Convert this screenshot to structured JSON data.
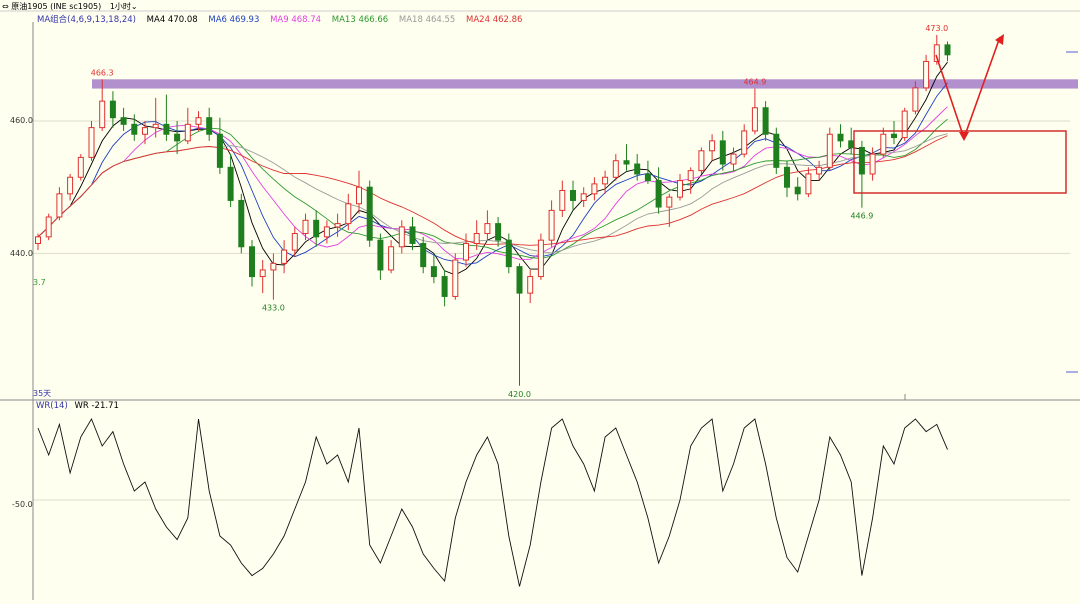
{
  "title_bar": {
    "symbol": "原油1905 (INE sc1905)",
    "period": "1小时"
  },
  "ma_legend": {
    "group": "MA组合(4,6,9,13,18,24)",
    "items": [
      {
        "label": "MA4 470.08",
        "color": "#000000"
      },
      {
        "label": "MA6 469.93",
        "color": "#1E3FBF"
      },
      {
        "label": "MA9 468.74",
        "color": "#E23FE2"
      },
      {
        "label": "MA13 466.66",
        "color": "#2F9A2F"
      },
      {
        "label": "MA18 464.55",
        "color": "#9A9A9A"
      },
      {
        "label": "MA24 462.86",
        "color": "#E03030"
      }
    ]
  },
  "y_ticks": [
    "460.0",
    "440.0"
  ],
  "left_clip_label": "3.7",
  "period_label": "35天",
  "wr_legend": {
    "name": "WR(14)",
    "value": "WR -21.71",
    "tick": "-50.0"
  },
  "colors": {
    "up": "#E03030",
    "down": "#1F7F1F",
    "band": "#A57BC7",
    "box": "#D02020",
    "arrow": "#E02020"
  },
  "chart_data": {
    "type": "candlestick",
    "title": "",
    "ylabel": "",
    "ylim": [
      414,
      476
    ],
    "resistance_band": [
      464.9,
      466.3
    ],
    "annotations": [
      {
        "text": "466.3",
        "index": 6,
        "value": 466.3
      },
      {
        "text": "433.0",
        "index": 22,
        "value": 433.0
      },
      {
        "text": "420.0",
        "index": 45,
        "value": 420.0
      },
      {
        "text": "464.9",
        "index": 67,
        "value": 464.9
      },
      {
        "text": "446.9",
        "index": 77,
        "value": 446.9
      },
      {
        "text": "473.0",
        "index": 84,
        "value": 473.0
      }
    ],
    "candles": [
      [
        441.5,
        443.0,
        440.5,
        442.5
      ],
      [
        442.5,
        446.0,
        442.0,
        445.5
      ],
      [
        445.5,
        450.0,
        445.0,
        449.0
      ],
      [
        449.0,
        452.0,
        448.0,
        451.5
      ],
      [
        451.5,
        455.0,
        451.0,
        454.5
      ],
      [
        454.5,
        460.0,
        454.0,
        459.0
      ],
      [
        459.0,
        466.3,
        458.5,
        463.0
      ],
      [
        463.0,
        464.5,
        459.0,
        460.5
      ],
      [
        460.5,
        462.0,
        458.5,
        459.5
      ],
      [
        459.5,
        461.0,
        457.0,
        458.0
      ],
      [
        458.0,
        460.0,
        456.5,
        459.0
      ],
      [
        459.0,
        463.5,
        457.5,
        459.5
      ],
      [
        459.5,
        464.0,
        457.0,
        458.0
      ],
      [
        458.0,
        460.0,
        455.0,
        457.0
      ],
      [
        457.0,
        462.0,
        456.5,
        459.5
      ],
      [
        459.5,
        461.5,
        458.5,
        460.5
      ],
      [
        460.5,
        462.0,
        457.0,
        458.0
      ],
      [
        458.0,
        460.5,
        452.0,
        453.0
      ],
      [
        453.0,
        455.0,
        447.0,
        448.0
      ],
      [
        448.0,
        449.0,
        440.0,
        441.0
      ],
      [
        441.0,
        442.0,
        435.0,
        436.5
      ],
      [
        436.5,
        439.0,
        434.0,
        437.5
      ],
      [
        437.5,
        440.0,
        433.0,
        438.5
      ],
      [
        438.5,
        442.0,
        437.0,
        440.5
      ],
      [
        440.5,
        444.0,
        439.5,
        443.0
      ],
      [
        443.0,
        446.0,
        442.0,
        445.0
      ],
      [
        445.0,
        446.5,
        441.0,
        442.5
      ],
      [
        442.5,
        445.0,
        441.5,
        444.0
      ],
      [
        444.0,
        446.0,
        442.5,
        444.5
      ],
      [
        444.5,
        449.0,
        443.5,
        447.5
      ],
      [
        447.5,
        452.5,
        446.0,
        450.0
      ],
      [
        450.0,
        451.0,
        441.0,
        442.0
      ],
      [
        442.0,
        443.0,
        436.0,
        437.5
      ],
      [
        437.5,
        442.0,
        437.0,
        441.0
      ],
      [
        441.0,
        445.0,
        440.0,
        444.0
      ],
      [
        444.0,
        445.5,
        440.5,
        441.5
      ],
      [
        441.5,
        442.5,
        437.0,
        438.0
      ],
      [
        438.0,
        440.0,
        435.5,
        436.5
      ],
      [
        436.5,
        437.5,
        432.0,
        433.5
      ],
      [
        433.5,
        440.0,
        433.0,
        439.0
      ],
      [
        439.0,
        443.0,
        438.0,
        441.5
      ],
      [
        441.5,
        445.0,
        440.5,
        443.0
      ],
      [
        443.0,
        446.5,
        442.0,
        444.5
      ],
      [
        444.5,
        445.5,
        441.0,
        442.0
      ],
      [
        442.0,
        443.0,
        437.0,
        438.0
      ],
      [
        438.0,
        438.5,
        420.0,
        434.0
      ],
      [
        434.0,
        437.5,
        432.5,
        436.5
      ],
      [
        436.5,
        443.0,
        436.0,
        442.0
      ],
      [
        442.0,
        448.0,
        441.0,
        446.5
      ],
      [
        446.5,
        451.0,
        445.5,
        449.5
      ],
      [
        449.5,
        451.0,
        446.5,
        448.0
      ],
      [
        448.0,
        450.0,
        447.0,
        449.0
      ],
      [
        449.0,
        451.5,
        448.0,
        450.5
      ],
      [
        450.5,
        452.5,
        449.0,
        451.5
      ],
      [
        451.5,
        455.0,
        451.0,
        454.0
      ],
      [
        454.0,
        456.5,
        452.5,
        453.5
      ],
      [
        453.5,
        455.0,
        451.0,
        452.0
      ],
      [
        452.0,
        454.0,
        450.5,
        451.0
      ],
      [
        451.0,
        453.0,
        446.0,
        447.0
      ],
      [
        447.0,
        449.0,
        444.0,
        448.5
      ],
      [
        448.5,
        452.0,
        448.0,
        451.0
      ],
      [
        451.0,
        453.0,
        449.0,
        452.5
      ],
      [
        452.5,
        456.0,
        452.0,
        455.5
      ],
      [
        455.5,
        458.0,
        454.0,
        457.0
      ],
      [
        457.0,
        458.5,
        452.5,
        453.5
      ],
      [
        453.5,
        456.0,
        452.5,
        455.0
      ],
      [
        455.0,
        459.5,
        454.5,
        458.5
      ],
      [
        458.5,
        464.9,
        458.0,
        462.0
      ],
      [
        462.0,
        463.0,
        457.0,
        458.0
      ],
      [
        458.0,
        459.0,
        452.0,
        453.0
      ],
      [
        453.0,
        454.0,
        448.5,
        450.0
      ],
      [
        450.0,
        451.5,
        448.0,
        449.0
      ],
      [
        449.0,
        453.0,
        448.5,
        452.0
      ],
      [
        452.0,
        454.0,
        451.0,
        453.0
      ],
      [
        453.0,
        459.0,
        452.5,
        458.0
      ],
      [
        458.0,
        459.5,
        456.0,
        457.0
      ],
      [
        457.0,
        459.0,
        455.0,
        456.0
      ],
      [
        456.0,
        457.0,
        446.9,
        452.0
      ],
      [
        452.0,
        456.0,
        451.0,
        455.0
      ],
      [
        455.0,
        459.0,
        454.5,
        458.0
      ],
      [
        458.0,
        460.0,
        456.5,
        457.5
      ],
      [
        457.5,
        462.0,
        457.0,
        461.5
      ],
      [
        461.5,
        466.0,
        461.0,
        465.0
      ],
      [
        465.0,
        470.0,
        464.5,
        469.0
      ],
      [
        469.0,
        473.0,
        468.5,
        471.5
      ],
      [
        471.5,
        472.0,
        469.0,
        470.0
      ]
    ],
    "wr": [
      -10,
      -25,
      -8,
      -35,
      -15,
      -5,
      -20,
      -12,
      -30,
      -45,
      -40,
      -55,
      -65,
      -72,
      -60,
      -5,
      -45,
      -70,
      -75,
      -85,
      -92,
      -88,
      -80,
      -70,
      -55,
      -40,
      -15,
      -30,
      -25,
      -40,
      -10,
      -75,
      -85,
      -70,
      -55,
      -65,
      -80,
      -88,
      -95,
      -60,
      -40,
      -25,
      -15,
      -30,
      -70,
      -98,
      -75,
      -40,
      -10,
      -5,
      -20,
      -30,
      -45,
      -15,
      -10,
      -25,
      -40,
      -60,
      -85,
      -70,
      -50,
      -20,
      -10,
      -5,
      -45,
      -30,
      -10,
      -5,
      -30,
      -60,
      -82,
      -90,
      -70,
      -50,
      -15,
      -25,
      -40,
      -92,
      -60,
      -20,
      -30,
      -10,
      -5,
      -12,
      -8,
      -22
    ]
  }
}
